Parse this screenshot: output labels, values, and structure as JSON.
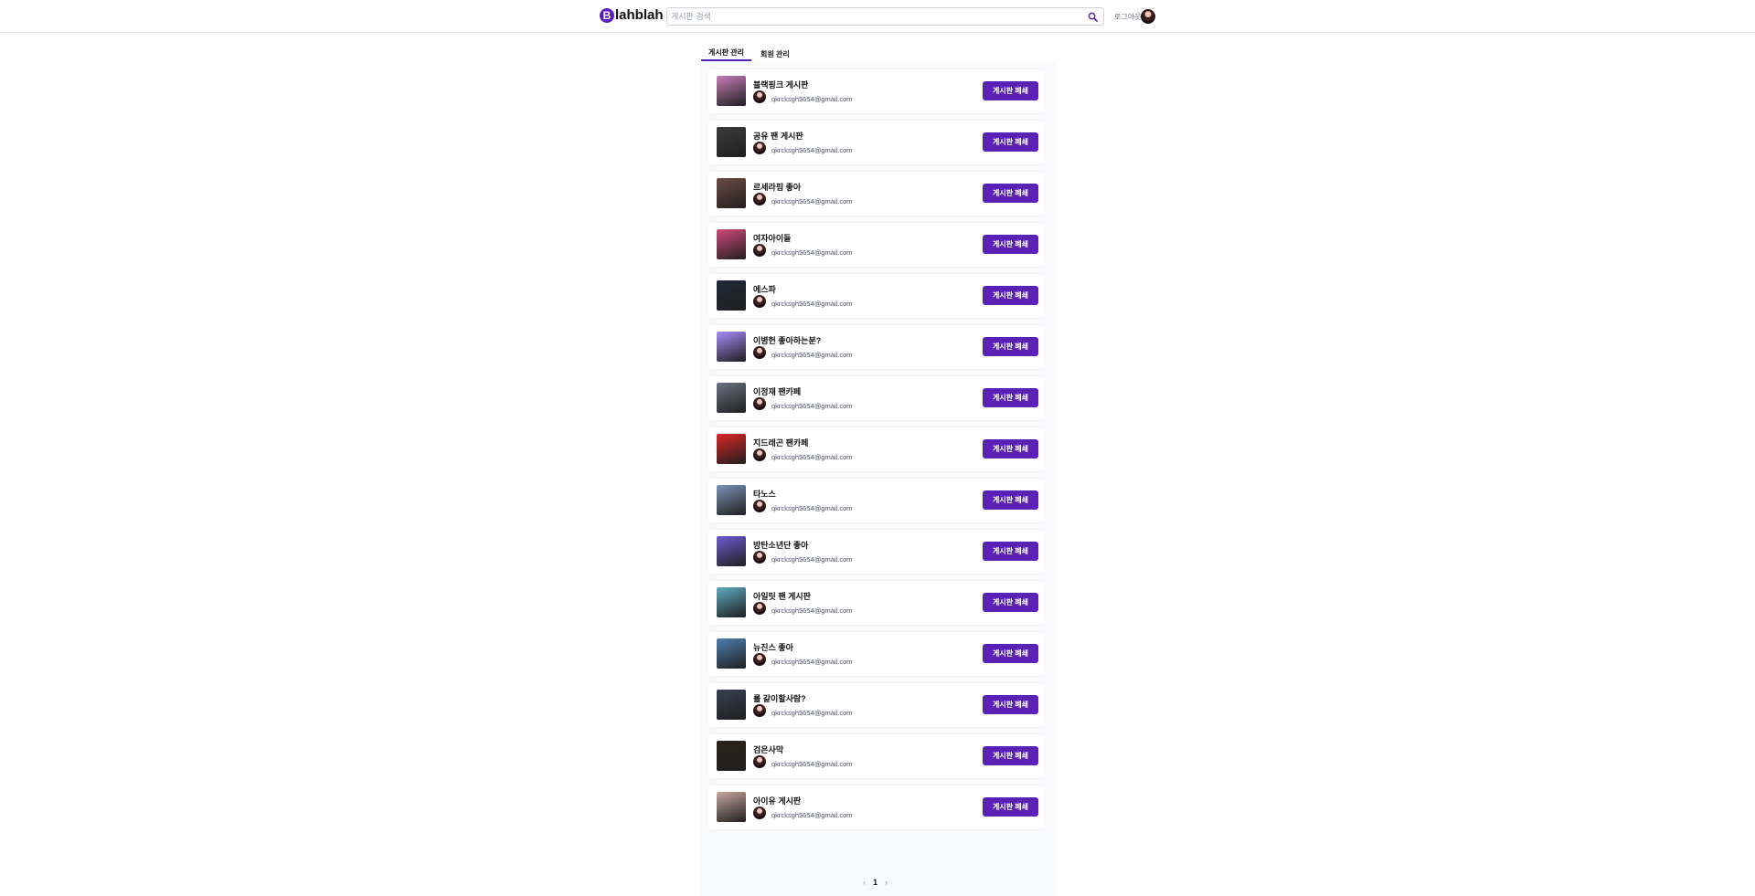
{
  "header": {
    "logo_letter": "B",
    "logo_text": "lahblah",
    "search_placeholder": "게시판 검색",
    "logout_label": "로그아웃"
  },
  "tabs": [
    {
      "label": "게시판 관리",
      "active": true
    },
    {
      "label": "회원 관리",
      "active": false
    }
  ],
  "boards": [
    {
      "title": "블랙핑크 게시판",
      "owner": "qkrcksgh5654@gmail.com",
      "thumb": "#c77dba"
    },
    {
      "title": "공유 팬 게시판",
      "owner": "qkrcksgh5654@gmail.com",
      "thumb": "#3b3b3b"
    },
    {
      "title": "르세라핌 좋아",
      "owner": "qkrcksgh5654@gmail.com",
      "thumb": "#6b4c44"
    },
    {
      "title": "여자아이들",
      "owner": "qkrcksgh5654@gmail.com",
      "thumb": "#d04a7a"
    },
    {
      "title": "에스파",
      "owner": "qkrcksgh5654@gmail.com",
      "thumb": "#1f2937"
    },
    {
      "title": "이병헌 좋아하는분?",
      "owner": "qkrcksgh5654@gmail.com",
      "thumb": "#a78bfa"
    },
    {
      "title": "이정재 팬카페",
      "owner": "qkrcksgh5654@gmail.com",
      "thumb": "#6b7280"
    },
    {
      "title": "지드래곤 팬카페",
      "owner": "qkrcksgh5654@gmail.com",
      "thumb": "#dc2626"
    },
    {
      "title": "타노스",
      "owner": "qkrcksgh5654@gmail.com",
      "thumb": "#7c93b8"
    },
    {
      "title": "방탄소년단 좋아",
      "owner": "qkrcksgh5654@gmail.com",
      "thumb": "#6d5bd0"
    },
    {
      "title": "아일릿 팬 게시판",
      "owner": "qkrcksgh5654@gmail.com",
      "thumb": "#5eaabf"
    },
    {
      "title": "뉴진스 좋아",
      "owner": "qkrcksgh5654@gmail.com",
      "thumb": "#4f7fb0"
    },
    {
      "title": "롤 같이할사람?",
      "owner": "qkrcksgh5654@gmail.com",
      "thumb": "#374151"
    },
    {
      "title": "검은사막",
      "owner": "qkrcksgh5654@gmail.com",
      "thumb": "#2b2418"
    },
    {
      "title": "아이유 게시판",
      "owner": "qkrcksgh5654@gmail.com",
      "thumb": "#c9a5a0"
    }
  ],
  "delete_label": "게시판 폐쇄",
  "pagination": {
    "prev": "‹",
    "current": "1",
    "next": "›"
  },
  "colors": {
    "accent": "#5b21b6"
  }
}
